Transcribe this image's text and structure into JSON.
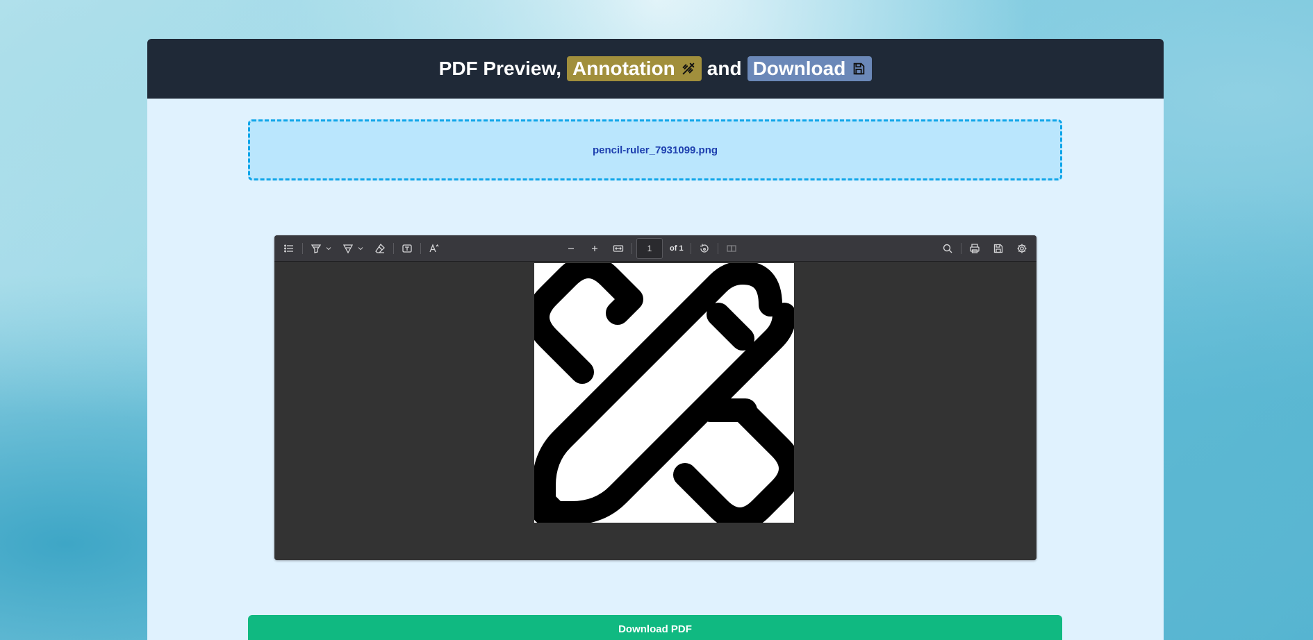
{
  "header": {
    "title_prefix": "PDF Preview,",
    "annotation_label": "Annotation",
    "conjunction": "and",
    "download_label": "Download"
  },
  "dropzone": {
    "filename": "pencil-ruler_7931099.png"
  },
  "viewer": {
    "page_number": "1",
    "page_total_label": "of 1"
  },
  "actions": {
    "download_pdf_label": "Download PDF"
  },
  "colors": {
    "header_bg": "#1f2937",
    "annotation_pill": "#a18f3c",
    "download_pill": "#6b88b8",
    "dropzone_border": "#0ea5e9",
    "download_button": "#10b981"
  }
}
